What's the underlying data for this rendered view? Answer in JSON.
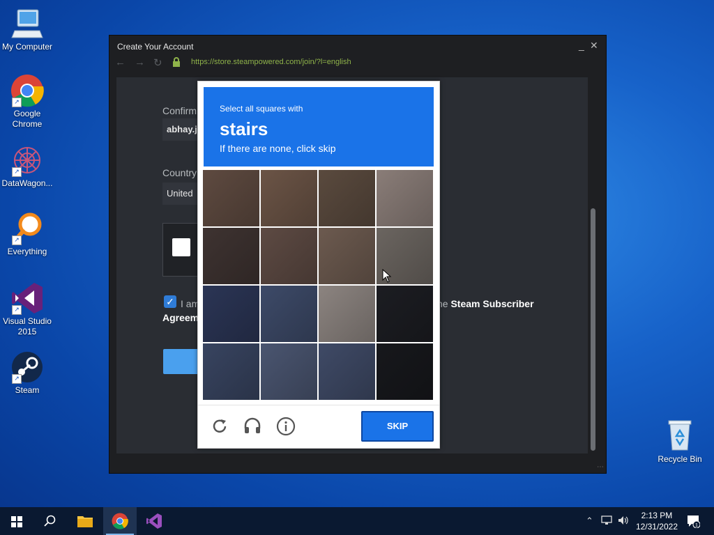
{
  "desktop": {
    "icons": [
      {
        "label": "My Computer"
      },
      {
        "label": "Google Chrome"
      },
      {
        "label": "DataWagon..."
      },
      {
        "label": "Everything"
      },
      {
        "label": "Visual Studio 2015"
      },
      {
        "label": "Steam"
      }
    ],
    "recycle_bin": "Recycle Bin"
  },
  "window": {
    "title": "Create Your Account",
    "minimize": "_",
    "close": "✕",
    "url": "https://store.steampowered.com/join/?l=english"
  },
  "form": {
    "confirm_label": "Confirm",
    "confirm_value": "abhay.j",
    "country_label": "Country",
    "country_value": "United",
    "agree_prefix": "I am",
    "agree_link_suffix": "he",
    "agree_link": "Steam Subscriber",
    "agree_line2": "Agreem"
  },
  "captcha": {
    "instruction": "Select all squares with",
    "target": "stairs",
    "hint": "If there are none, click skip",
    "skip_label": "SKIP",
    "tile_colors": [
      "#5e4a40",
      "#6b5446",
      "#5a4a3e",
      "#8a7d78",
      "#3e3331",
      "#5d4a43",
      "#6c5a4f",
      "#6b6560",
      "#2b3555",
      "#3d4a68",
      "#8c8480",
      "#1c1d22",
      "#384460",
      "#4a5570",
      "#3f4a66",
      "#17181c"
    ]
  },
  "taskbar": {
    "time": "2:13 PM",
    "date": "12/31/2022"
  }
}
